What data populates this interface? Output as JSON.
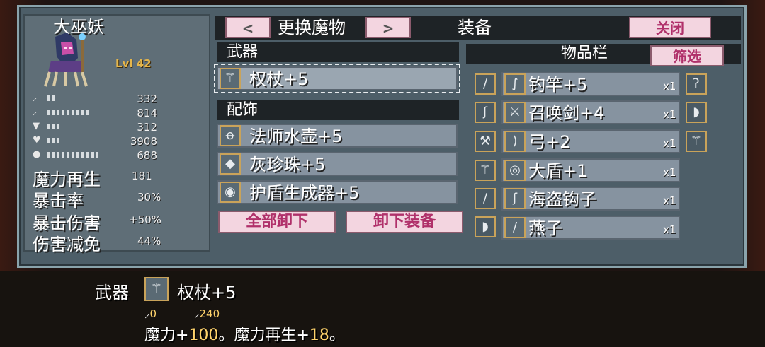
{
  "character": {
    "name": "大巫妖",
    "level": "Lvl 42",
    "stats": [
      {
        "icon": "sword-icon",
        "value": "332",
        "fill": 0.1
      },
      {
        "icon": "staff-icon",
        "value": "814",
        "fill": 0.55
      },
      {
        "icon": "shield-icon",
        "value": "312",
        "fill": 0.18
      },
      {
        "icon": "heart-icon",
        "value": "3908",
        "fill": 0.18
      },
      {
        "icon": "potion-icon",
        "value": "688",
        "fill": 0.65
      }
    ],
    "extra": [
      {
        "label": "魔力再生",
        "value": "181"
      },
      {
        "label": "暴击率",
        "value": "30%"
      },
      {
        "label": "暴击伤害",
        "value": "+50%"
      },
      {
        "label": "伤害减免",
        "value": "44%"
      }
    ]
  },
  "top": {
    "prev": "<",
    "change_label": "更换魔物",
    "next": ">",
    "equip_label": "装备",
    "close": "关闭"
  },
  "equipment": {
    "weapon_header": "武器",
    "weapon": {
      "name": "权杖+5",
      "icon": "scepter-icon"
    },
    "accessory_header": "配饰",
    "accessories": [
      {
        "name": "法师水壶+5",
        "icon": "flask-icon"
      },
      {
        "name": "灰珍珠+5",
        "icon": "pearl-icon"
      },
      {
        "name": "护盾生成器+5",
        "icon": "shield-generator-icon"
      }
    ],
    "unequip_all": "全部卸下",
    "unequip": "卸下装备"
  },
  "inventory": {
    "header": "物品栏",
    "filter": "筛选",
    "items": [
      {
        "name": "钓竿+5",
        "qty": "x1",
        "icon": "fishing-rod-icon"
      },
      {
        "name": "召唤剑+4",
        "qty": "x1",
        "icon": "summon-sword-icon"
      },
      {
        "name": "弓+2",
        "qty": "x1",
        "icon": "bow-icon"
      },
      {
        "name": "大盾+1",
        "qty": "x1",
        "icon": "large-shield-icon"
      },
      {
        "name": "海盗钩子",
        "qty": "x1",
        "icon": "pirate-hook-icon"
      },
      {
        "name": "燕子",
        "qty": "x1",
        "icon": "swallow-icon"
      }
    ]
  },
  "detail": {
    "category": "武器",
    "name": "权杖+5",
    "atk": "0",
    "matk": "240",
    "desc_a": "魔力+",
    "desc_a_val": "100",
    "desc_sep": "。",
    "desc_b": "魔力再生+",
    "desc_b_val": "18",
    "desc_end": "。"
  }
}
